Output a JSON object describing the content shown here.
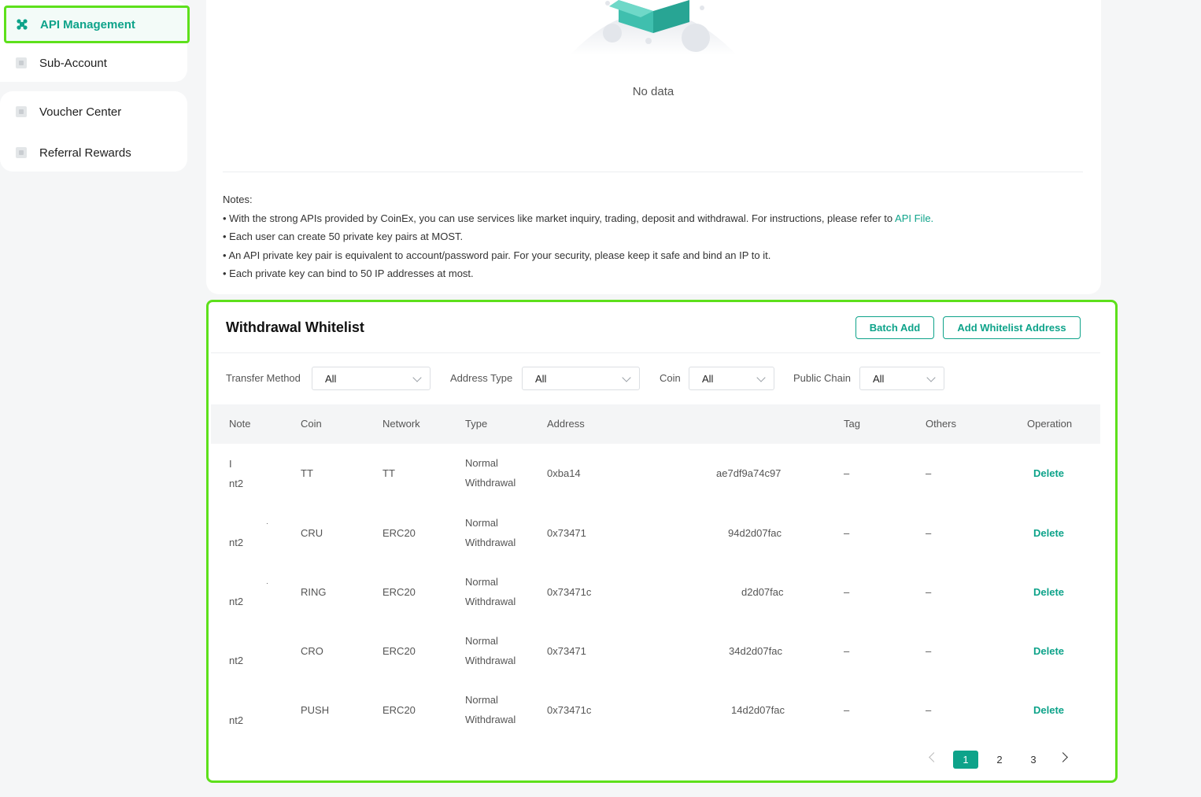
{
  "sidebar": {
    "items": [
      {
        "label": "API Management",
        "icon": "api-icon",
        "active": true
      },
      {
        "label": "Sub-Account",
        "icon": "sub-account-icon"
      },
      {
        "label": "Voucher Center",
        "icon": "voucher-icon"
      },
      {
        "label": "Referral Rewards",
        "icon": "referral-icon"
      }
    ]
  },
  "api": {
    "no_data": "No data",
    "notes_title": "Notes:",
    "notes": [
      "• With the strong APIs provided by CoinEx, you can use services like market inquiry, trading, deposit and withdrawal. For instructions, please refer to ",
      "• Each user can create 50 private key pairs at MOST.",
      "• An API private key pair is equivalent to account/password pair. For your security, please keep it safe and bind an IP to it.",
      "• Each private key can bind to 50 IP addresses at most."
    ],
    "api_file_link": "API File."
  },
  "whitelist": {
    "title": "Withdrawal Whitelist",
    "batch_add": "Batch Add",
    "add_address": "Add Whitelist Address",
    "filters": {
      "transfer_method": {
        "label": "Transfer Method",
        "value": "All"
      },
      "address_type": {
        "label": "Address Type",
        "value": "All"
      },
      "coin": {
        "label": "Coin",
        "value": "All"
      },
      "public_chain": {
        "label": "Public Chain",
        "value": "All"
      }
    },
    "columns": [
      "Note",
      "Coin",
      "Network",
      "Type",
      "Address",
      "Tag",
      "Others",
      "Operation"
    ],
    "rows": [
      {
        "note_a": "I",
        "note_b": "nt2",
        "coin": "TT",
        "network": "TT",
        "type_a": "Normal",
        "type_b": "Withdrawal",
        "addr_start": "0xba14",
        "addr_end": "ae7df9a74c97",
        "tag": "–",
        "others": "–",
        "op": "Delete"
      },
      {
        "note_a": "·",
        "note_b": "nt2",
        "coin": "CRU",
        "network": "ERC20",
        "type_a": "Normal",
        "type_b": "Withdrawal",
        "addr_start": "0x73471",
        "addr_end": "94d2d07fac",
        "tag": "–",
        "others": "–",
        "op": "Delete"
      },
      {
        "note_a": "·",
        "note_b": "nt2",
        "coin": "RING",
        "network": "ERC20",
        "type_a": "Normal",
        "type_b": "Withdrawal",
        "addr_start": "0x73471c",
        "addr_end": "d2d07fac",
        "tag": "–",
        "others": "–",
        "op": "Delete"
      },
      {
        "note_a": "",
        "note_b": "nt2",
        "coin": "CRO",
        "network": "ERC20",
        "type_a": "Normal",
        "type_b": "Withdrawal",
        "addr_start": "0x73471",
        "addr_end": "34d2d07fac",
        "tag": "–",
        "others": "–",
        "op": "Delete"
      },
      {
        "note_a": "",
        "note_b": "nt2",
        "coin": "PUSH",
        "network": "ERC20",
        "type_a": "Normal",
        "type_b": "Withdrawal",
        "addr_start": "0x73471c",
        "addr_end": "14d2d07fac",
        "tag": "–",
        "others": "–",
        "op": "Delete"
      }
    ],
    "pagination": {
      "pages": [
        "1",
        "2",
        "3"
      ],
      "current": "1"
    }
  },
  "colors": {
    "accent": "#0ea38a",
    "highlight": "#5de01b"
  }
}
